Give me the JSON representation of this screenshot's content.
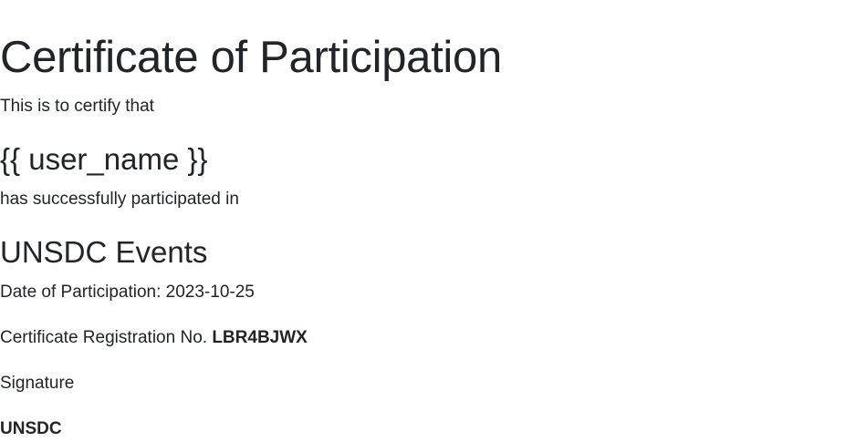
{
  "certificate": {
    "title": "Certificate of Participation",
    "intro": "This is to certify that",
    "recipient_name": "{{ user_name }}",
    "participated_text": "has successfully participated in",
    "event_name": "UNSDC Events",
    "date_label": "Date of Participation:",
    "date_value": "2023-10-25",
    "registration_label": "Certificate Registration No.",
    "registration_number": "LBR4BJWX",
    "signature_label": "Signature",
    "signatory": "UNSDC"
  }
}
